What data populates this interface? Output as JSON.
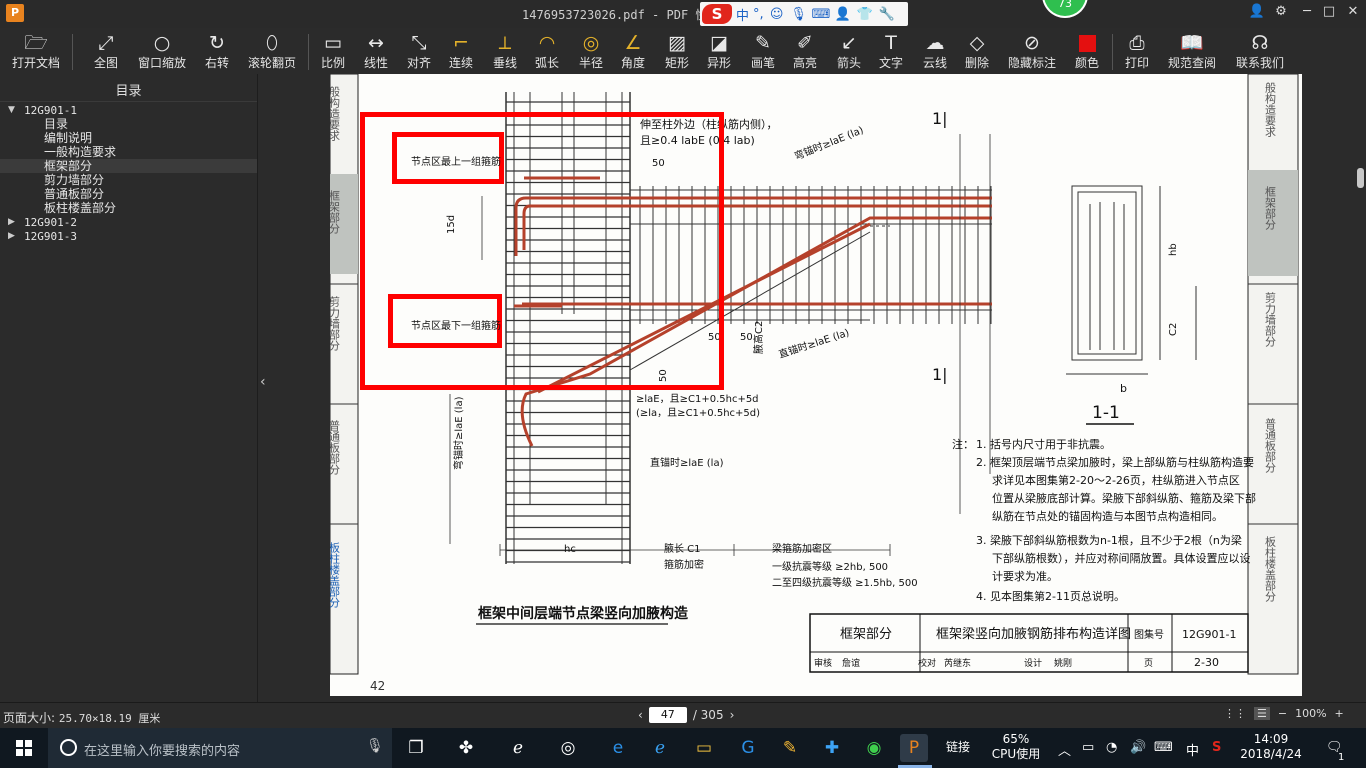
{
  "titlebar": {
    "logo": "P",
    "title": "1476953723026.pdf - PDF 快速看",
    "ime": {
      "lang": "中",
      "punct": "°,"
    },
    "badge": "73",
    "controls": {
      "user": "👤",
      "settings": "⚙",
      "min": "─",
      "max": "□",
      "close": "✕"
    }
  },
  "toolbar": {
    "items": [
      {
        "label": "打开文档",
        "icon": "folder-icon"
      },
      {
        "label": "全图",
        "icon": "fit-page-icon"
      },
      {
        "label": "窗口缩放",
        "icon": "zoom-icon"
      },
      {
        "label": "右转",
        "icon": "rotate-right-icon"
      },
      {
        "label": "滚轮翻页",
        "icon": "mouse-icon"
      },
      {
        "label": "比例",
        "icon": "ruler-icon"
      },
      {
        "label": "线性",
        "icon": "linear-icon"
      },
      {
        "label": "对齐",
        "icon": "align-icon"
      },
      {
        "label": "连续",
        "icon": "continuous-icon"
      },
      {
        "label": "垂线",
        "icon": "perpendicular-icon"
      },
      {
        "label": "弧长",
        "icon": "arc-length-icon"
      },
      {
        "label": "半径",
        "icon": "radius-icon"
      },
      {
        "label": "角度",
        "icon": "angle-icon"
      },
      {
        "label": "矩形",
        "icon": "rectangle-icon"
      },
      {
        "label": "异形",
        "icon": "polygon-icon"
      },
      {
        "label": "画笔",
        "icon": "pen-icon"
      },
      {
        "label": "高亮",
        "icon": "highlighter-icon"
      },
      {
        "label": "箭头",
        "icon": "arrow-icon"
      },
      {
        "label": "文字",
        "icon": "text-icon"
      },
      {
        "label": "云线",
        "icon": "cloud-icon"
      },
      {
        "label": "删除",
        "icon": "eraser-icon"
      },
      {
        "label": "隐藏标注",
        "icon": "hide-eye-icon"
      },
      {
        "label": "颜色",
        "icon": "color-swatch-icon"
      },
      {
        "label": "打印",
        "icon": "printer-icon"
      },
      {
        "label": "规范查阅",
        "icon": "book-icon"
      },
      {
        "label": "联系我们",
        "icon": "support-icon"
      }
    ],
    "active_color": "#e41010"
  },
  "sidebar": {
    "title": "目录",
    "tree": [
      {
        "label": "12G901-1",
        "level": 0,
        "expanded": true
      },
      {
        "label": "目录",
        "level": 1
      },
      {
        "label": "编制说明",
        "level": 1
      },
      {
        "label": "一般构造要求",
        "level": 1
      },
      {
        "label": "框架部分",
        "level": 1,
        "selected": true
      },
      {
        "label": "剪力墙部分",
        "level": 1
      },
      {
        "label": "普通板部分",
        "level": 1
      },
      {
        "label": "板柱楼盖部分",
        "level": 1
      },
      {
        "label": "12G901-2",
        "level": 0,
        "expanded": false
      },
      {
        "label": "12G901-3",
        "level": 0,
        "expanded": false
      }
    ]
  },
  "document": {
    "left_tabs": [
      "般构造要求",
      "框架部分",
      "剪力墙部分",
      "普通板部分",
      "板柱楼盖部分"
    ],
    "right_tabs": [
      "般构造要求",
      "框架部分",
      "剪力墙部分",
      "普通板部分",
      "板柱楼盖部分"
    ],
    "annotation_top": "节点区最上一组箍筋",
    "annotation_bottom": "节点区最下一组箍筋",
    "label_extend": "伸至柱外边（柱纵筋内侧），",
    "label_extend2": "且≥0.4 labE (0.4 lab)",
    "label_bend_top": "弯锚时≥laE (la)",
    "label_bend_left": "弯锚时≥laE (la)",
    "label_straight1": "直锚时≥laE (la)",
    "label_straight2": "直锚时≥laE (la)",
    "label_haunch_c2": "腋高C2",
    "label_cond1": "≥laE，且≥C1+0.5hc+5d",
    "label_cond2": "(≥la，且≥C1+0.5hc+5d)",
    "dims": {
      "d50a": "50",
      "d50b": "50",
      "d50c": "50",
      "d50d": "50",
      "d15d": "15d",
      "hc": "hc"
    },
    "haunch_len": "腋长 C1",
    "stirrup_dense": "箍筋加密",
    "beam_dense_zone": "梁箍筋加密区",
    "dense_1": "一级抗震等级  ≥2hb, 500",
    "dense_2": "二至四级抗震等级  ≥1.5hb, 500",
    "caption": "框架中间层端节点梁竖向加腋构造",
    "section_mark": "1|",
    "section_mark2": "1|",
    "section_title": "1-1",
    "section_b": "b",
    "section_hb": "hb",
    "section_c2": "C2",
    "notes_title": "注：",
    "notes": [
      "1. 括号内尺寸用于非抗震。",
      "2. 框架顶层端节点梁加腋时，梁上部纵筋与柱纵筋构造要",
      "求详见本图集第2-20～2-26页，柱纵筋进入节点区",
      "位置从梁腋底部计算。梁腋下部斜纵筋、箍筋及梁下部",
      "纵筋在节点处的锚固构造与本图节点构造相同。",
      "3. 梁腋下部斜纵筋根数为n-1根，且不少于2根（n为梁",
      "下部纵筋根数），并应对称间隔放置。具体设置应以设",
      "计要求为准。",
      "4. 见本图集第2-11页总说明。"
    ],
    "titleblock": {
      "section": "框架部分",
      "drawing_title": "框架梁竖向加腋钢筋排布构造详图",
      "atlas_label": "图集号",
      "atlas_no": "12G901-1",
      "review": "审核",
      "reviewer": "詹谊",
      "check": "校对",
      "checker": "芮继东",
      "design": "设计",
      "designer": "姚刚",
      "page_label": "页",
      "page_no": "2-30"
    },
    "page_number": "42"
  },
  "status": {
    "page_size_label": "页面大小:",
    "page_size_value": "25.70×18.19 厘米",
    "current_page": "47",
    "total_pages": "/ 305",
    "zoom": "100%",
    "zoom_minus": "−",
    "zoom_plus": "+"
  },
  "taskbar": {
    "search_placeholder": "在这里输入你要搜索的内容",
    "network_label": "链接",
    "cpu_percent": "65%",
    "cpu_label": "CPU使用",
    "ime": "中",
    "time": "14:09",
    "date": "2018/4/24",
    "notif_count": "1"
  }
}
